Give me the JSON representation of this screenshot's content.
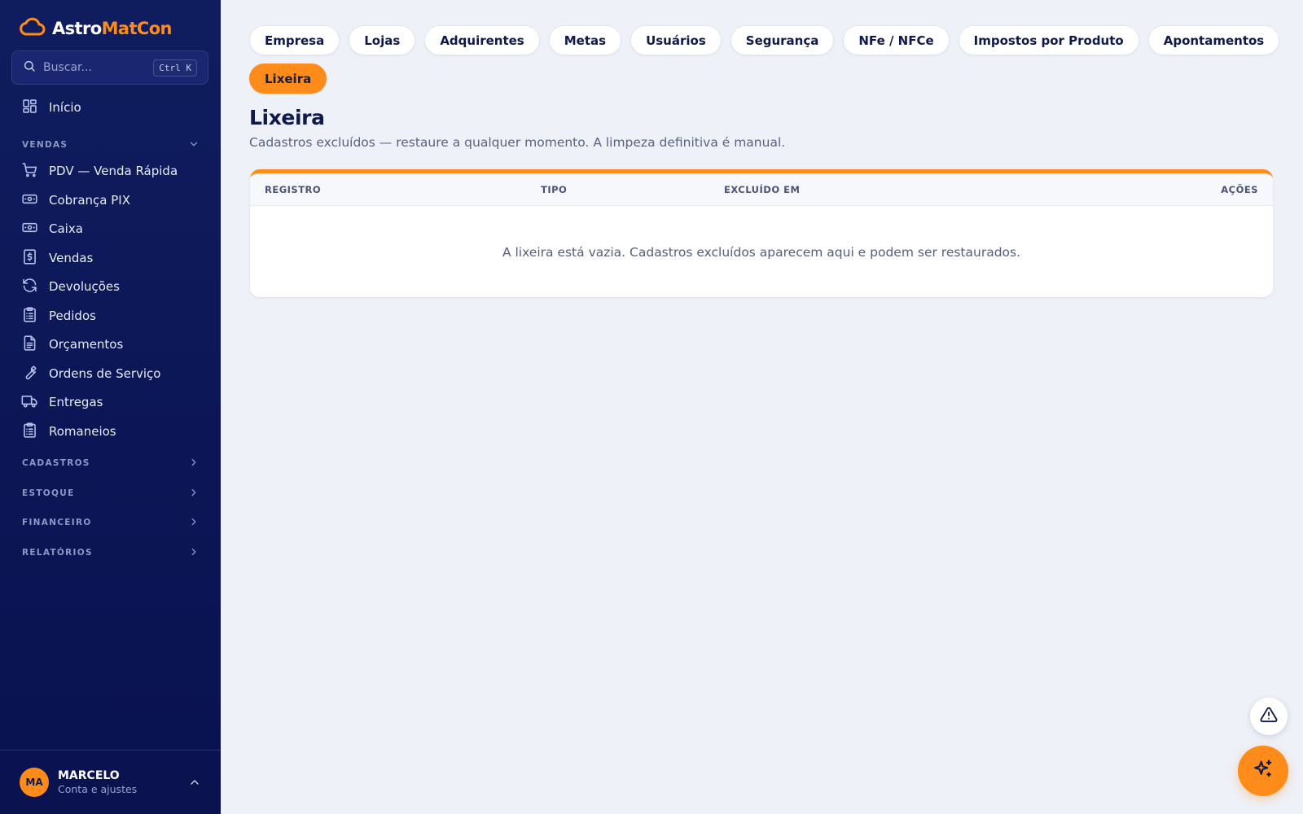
{
  "brand": {
    "part1": "Astro",
    "part2": "MatCon"
  },
  "search": {
    "placeholder": "Buscar...",
    "shortcut": "Ctrl K"
  },
  "sidebar": {
    "home": "Início",
    "sections": {
      "vendas": "VENDAS",
      "cadastros": "CADASTROS",
      "estoque": "ESTOQUE",
      "financeiro": "FINANCEIRO",
      "relatorios": "RELATÓRIOS"
    },
    "items": [
      {
        "label": "PDV — Venda Rápida",
        "icon": "cart-icon"
      },
      {
        "label": "Cobrança PIX",
        "icon": "banknote-icon"
      },
      {
        "label": "Caixa",
        "icon": "banknote-icon"
      },
      {
        "label": "Vendas",
        "icon": "receipt-dollar-icon"
      },
      {
        "label": "Devoluções",
        "icon": "refresh-icon"
      },
      {
        "label": "Pedidos",
        "icon": "clipboard-icon"
      },
      {
        "label": "Orçamentos",
        "icon": "document-icon"
      },
      {
        "label": "Ordens de Serviço",
        "icon": "wrench-icon"
      },
      {
        "label": "Entregas",
        "icon": "truck-icon"
      },
      {
        "label": "Romaneios",
        "icon": "clipboard-icon"
      }
    ]
  },
  "user": {
    "initials": "MA",
    "name": "MARCELO",
    "subtitle": "Conta e ajustes"
  },
  "tabs": [
    {
      "label": "Empresa",
      "active": false
    },
    {
      "label": "Lojas",
      "active": false
    },
    {
      "label": "Adquirentes",
      "active": false
    },
    {
      "label": "Metas",
      "active": false
    },
    {
      "label": "Usuários",
      "active": false
    },
    {
      "label": "Segurança",
      "active": false
    },
    {
      "label": "NFe / NFCe",
      "active": false
    },
    {
      "label": "Impostos por Produto",
      "active": false
    },
    {
      "label": "Apontamentos",
      "active": false
    },
    {
      "label": "Lixeira",
      "active": true
    }
  ],
  "page": {
    "title": "Lixeira",
    "subtitle": "Cadastros excluídos — restaure a qualquer momento. A limpeza definitiva é manual."
  },
  "table": {
    "columns": {
      "registro": "REGISTRO",
      "tipo": "TIPO",
      "excluido": "EXCLUÍDO EM",
      "acoes": "AÇÕES"
    },
    "empty_message": "A lixeira está vazia. Cadastros excluídos aparecem aqui e podem ser restaurados."
  },
  "colors": {
    "accent": "#ff8c1a",
    "sidebar": "#0f1d5e",
    "background": "#eef1f8",
    "navy": "#0f1a4a"
  }
}
